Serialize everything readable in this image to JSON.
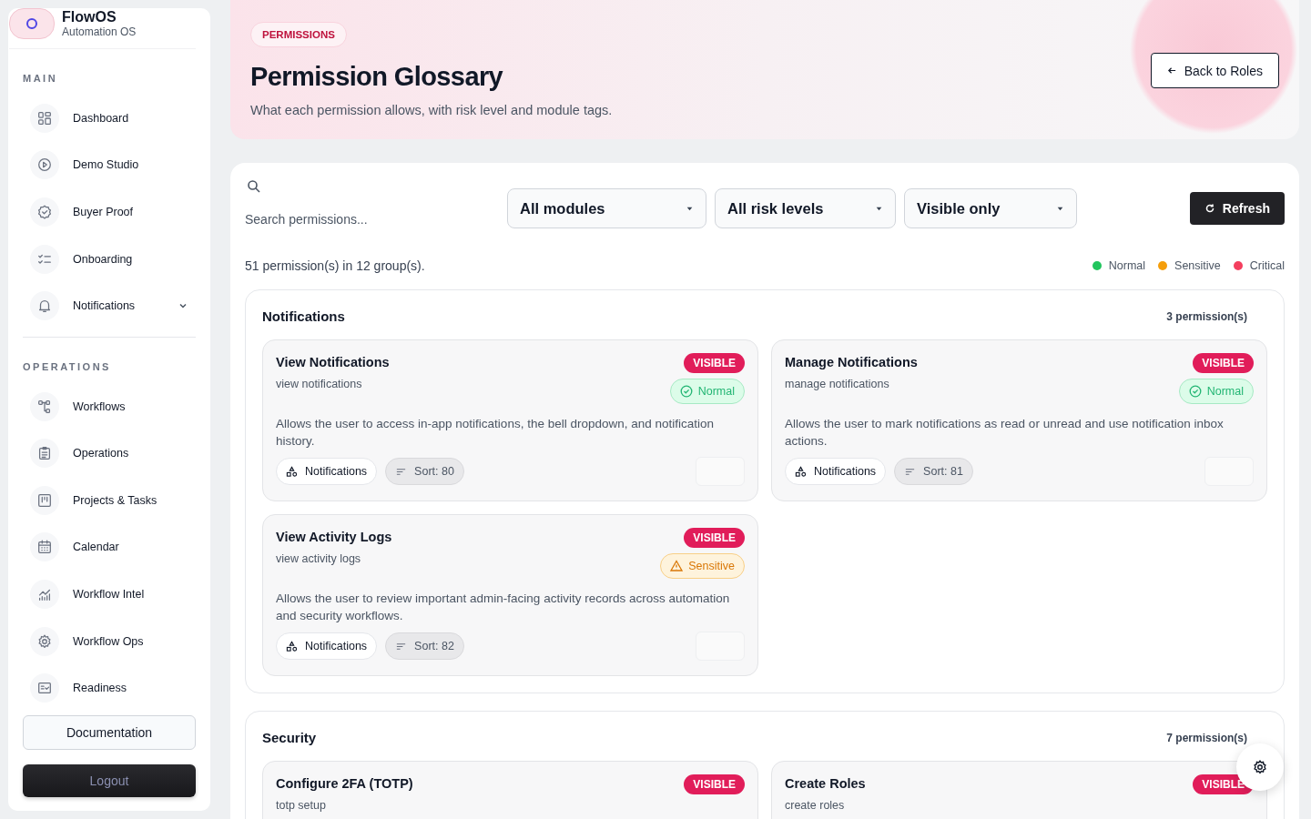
{
  "sidebar": {
    "brand": {
      "name": "FlowOS",
      "subtitle": "Automation OS"
    },
    "sections": [
      {
        "title": "MAIN",
        "items": [
          {
            "label": "Dashboard",
            "expandable": false
          },
          {
            "label": "Demo Studio",
            "expandable": false
          },
          {
            "label": "Buyer Proof",
            "expandable": false
          },
          {
            "label": "Onboarding",
            "expandable": false
          },
          {
            "label": "Notifications",
            "expandable": true
          }
        ]
      },
      {
        "title": "OPERATIONS",
        "items": [
          {
            "label": "Workflows",
            "expandable": false
          },
          {
            "label": "Operations",
            "expandable": false
          },
          {
            "label": "Projects & Tasks",
            "expandable": false
          },
          {
            "label": "Calendar",
            "expandable": false
          },
          {
            "label": "Workflow Intel",
            "expandable": false
          },
          {
            "label": "Workflow Ops",
            "expandable": false
          },
          {
            "label": "Readiness",
            "expandable": false
          }
        ]
      }
    ],
    "documentation_button": "Documentation",
    "logout_button": "Logout"
  },
  "header": {
    "badge": "PERMISSIONS",
    "title": "Permission Glossary",
    "subtitle": "What each permission allows, with risk level and module tags.",
    "back_button": "Back to Roles"
  },
  "filters": {
    "search": {
      "placeholder": "Search permissions..."
    },
    "dropdowns": [
      "All modules",
      "All risk levels",
      "Visible only"
    ],
    "refresh_button": "Refresh"
  },
  "summary": "51 permission(s) in 12 group(s).",
  "legend": [
    {
      "label": "Normal",
      "color": "#22c55e"
    },
    {
      "label": "Sensitive",
      "color": "#f59e0b"
    },
    {
      "label": "Critical",
      "color": "#f43f5e"
    }
  ],
  "groups": [
    {
      "title": "Notifications",
      "count": "3 permission(s)",
      "permissions": [
        {
          "title": "View Notifications",
          "key": "view notifications",
          "visible": true,
          "visible_badge": "VISIBLE",
          "kind": "normal",
          "risk_label": "Normal",
          "description": "Allows the user to access in-app notifications, the bell dropdown, and notification history.",
          "module": "Notifications",
          "sort": "Sort: 80"
        },
        {
          "title": "Manage Notifications",
          "key": "manage notifications",
          "visible": true,
          "visible_badge": "VISIBLE",
          "kind": "normal",
          "risk_label": "Normal",
          "description": "Allows the user to mark notifications as read or unread and use notification inbox actions.",
          "module": "Notifications",
          "sort": "Sort: 81"
        },
        {
          "title": "View Activity Logs",
          "key": "view activity logs",
          "visible": true,
          "visible_badge": "VISIBLE",
          "kind": "sensitive",
          "risk_label": "Sensitive",
          "description": "Allows the user to review important admin-facing activity records across automation and security workflows.",
          "module": "Notifications",
          "sort": "Sort: 82"
        }
      ]
    },
    {
      "title": "Security",
      "count": "7 permission(s)",
      "permissions": [
        {
          "title": "Configure 2FA (TOTP)",
          "key": "totp setup",
          "visible": true,
          "visible_badge": "VISIBLE"
        },
        {
          "title": "Create Roles",
          "key": "create roles",
          "visible": true,
          "visible_badge": "VISIBLE"
        }
      ]
    }
  ]
}
